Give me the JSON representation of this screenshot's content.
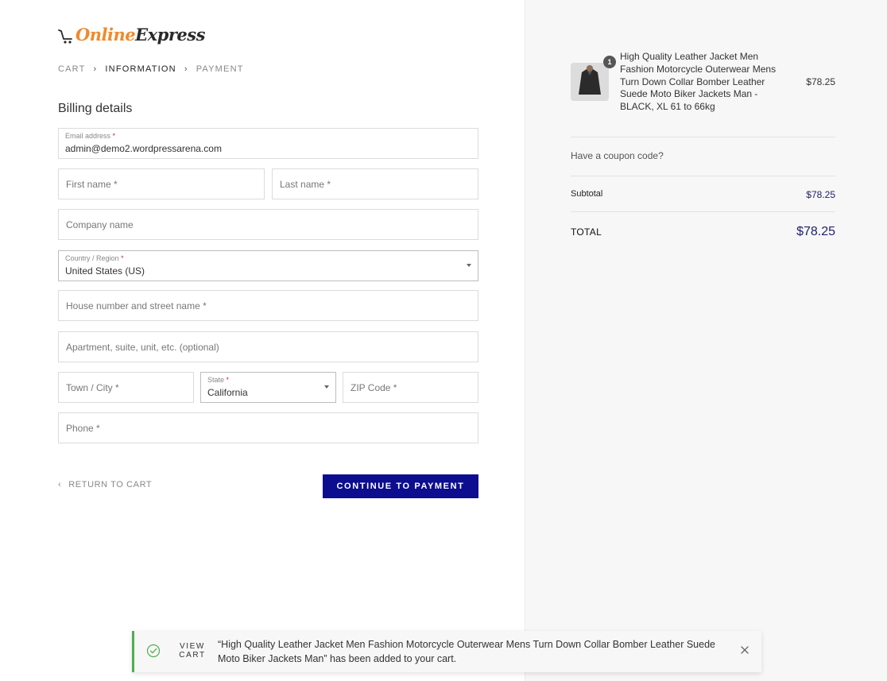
{
  "logo": {
    "word1": "Online",
    "word2": "Express",
    "icon": "cart-icon"
  },
  "breadcrumb": {
    "cart": "CART",
    "information": "INFORMATION",
    "payment": "PAYMENT"
  },
  "billing_title": "Billing details",
  "fields": {
    "email": {
      "label": "Email address",
      "required": "*",
      "value": "admin@demo2.wordpressarena.com"
    },
    "first_name": {
      "placeholder": "First name *"
    },
    "last_name": {
      "placeholder": "Last name *"
    },
    "company": {
      "placeholder": "Company name"
    },
    "country": {
      "label": "Country / Region",
      "required": "*",
      "value": "United States (US)"
    },
    "street": {
      "placeholder": "House number and street name *"
    },
    "apartment": {
      "placeholder": "Apartment, suite, unit, etc. (optional)"
    },
    "city": {
      "placeholder": "Town / City *"
    },
    "state": {
      "label": "State",
      "required": "*",
      "value": "California"
    },
    "zip": {
      "placeholder": "ZIP Code *"
    },
    "phone": {
      "placeholder": "Phone *"
    }
  },
  "actions": {
    "return_to_cart": "RETURN TO CART",
    "continue": "CONTINUE TO PAYMENT"
  },
  "summary": {
    "product": {
      "quantity": "1",
      "name": "High Quality Leather Jacket Men Fashion Motorcycle Outerwear Mens Turn Down Collar Bomber Leather Suede Moto Biker Jackets Man - BLACK, XL 61 to 66kg",
      "price": "$78.25"
    },
    "coupon": "Have a coupon code?",
    "subtotal_label": "Subtotal",
    "subtotal_value": "$78.25",
    "total_label": "TOTAL",
    "total_value": "$78.25"
  },
  "notice": {
    "view_cart_line1": "VIEW",
    "view_cart_line2": "CART",
    "message": "“High Quality Leather Jacket Men Fashion Motorcycle Outerwear Mens Turn Down Collar Bomber Leather Suede Moto Biker Jackets Man” has been added to your cart."
  },
  "colors": {
    "accent": "#0d0d8f",
    "logo_orange": "#f08a2c",
    "price_navy": "#20216b",
    "success": "#4caf50"
  }
}
